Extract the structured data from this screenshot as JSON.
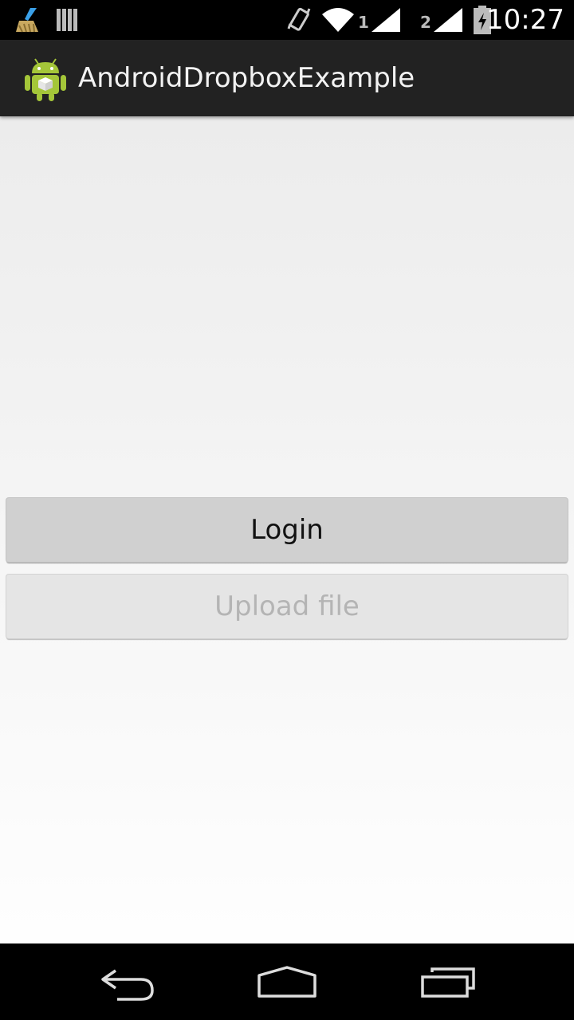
{
  "status_bar": {
    "time": "10:27",
    "sim1_label": "1",
    "sim2_label": "2",
    "icons": [
      "cleaner-broom-icon",
      "barcode-icon",
      "vibrate-icon",
      "wifi-icon",
      "signal-icon",
      "signal-icon",
      "battery-charging-icon"
    ]
  },
  "action_bar": {
    "app_title": "AndroidDropboxExample",
    "app_icon": "android-app-icon"
  },
  "main": {
    "login_label": "Login",
    "upload_label": "Upload file"
  },
  "nav_bar": {
    "icons": [
      "back-icon",
      "home-icon",
      "recent-apps-icon"
    ]
  },
  "colors": {
    "status_bar_bg": "#000000",
    "action_bar_bg": "#222222",
    "button_bg": "#d0d0d0",
    "button_disabled_bg": "#e5e5e5",
    "button_disabled_text": "#b4b4b4"
  }
}
